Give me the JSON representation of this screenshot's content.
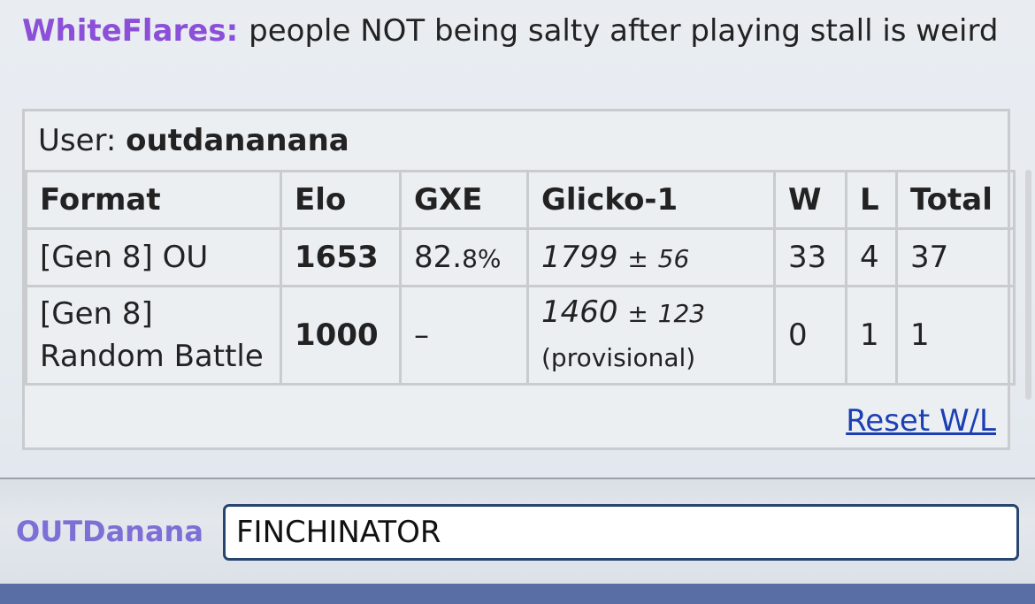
{
  "chat": {
    "message": {
      "user": "WhiteFlares:",
      "text": "people NOT being salty after playing stall is weird"
    },
    "ranking": {
      "user_label": "User:",
      "username": "outdananana",
      "headers": {
        "format": "Format",
        "elo": "Elo",
        "gxe": "GXE",
        "glicko": "Glicko-1",
        "w": "W",
        "l": "L",
        "total": "Total"
      },
      "rows": [
        {
          "format": "[Gen 8] OU",
          "elo": "1653",
          "gxe_main": "82.",
          "gxe_small": "8%",
          "glicko_value": "1799",
          "glicko_pm": "±",
          "glicko_dev": "56",
          "w": "33",
          "l": "4",
          "total": "37"
        },
        {
          "format_line1": "[Gen 8]",
          "format_line2": "Random Battle",
          "elo": "1000",
          "gxe": "–",
          "glicko_value": "1460",
          "glicko_pm": "±",
          "glicko_dev": "123",
          "glicko_note": "(provisional)",
          "w": "0",
          "l": "1",
          "total": "1"
        }
      ],
      "reset_label": "Reset W/L"
    }
  },
  "chatbar": {
    "self_name": "OUTDanana",
    "input_value": "FINCHINATOR"
  },
  "colors": {
    "username_purple": "#8b4fd8",
    "self_name_purple": "#7d6fd6",
    "link_blue": "#1c3fb4",
    "input_border": "#27456e",
    "bottom_strip": "#5a6ea6"
  }
}
